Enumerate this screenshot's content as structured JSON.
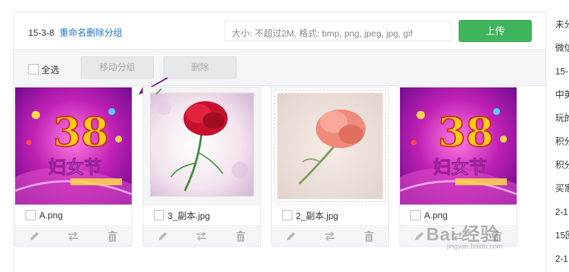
{
  "header": {
    "group_name": "15-3-8",
    "rename_link": "重命名",
    "delete_group_link": "删除分组",
    "upload_hint": "大小: 不超过2M,    格式: bmp, png, jpeg, jpg, gif",
    "upload_button": "上传"
  },
  "toolbar": {
    "select_all": "全选",
    "move_group": "移动分组",
    "delete": "删除"
  },
  "images": [
    {
      "filename": "A.png",
      "thumb": "womens-day-poster"
    },
    {
      "filename": "3_副本.jpg",
      "thumb": "red-carnation-photo"
    },
    {
      "filename": "2_副本.jpg",
      "thumb": "pink-carnation-photo"
    },
    {
      "filename": "A.png",
      "thumb": "womens-day-poster"
    }
  ],
  "sidebar": {
    "items": [
      "未分",
      "微信",
      "15-",
      "中英",
      "玩的",
      "积分",
      "积分",
      "买家",
      "2-1",
      "15回",
      "2-1"
    ]
  },
  "watermark": {
    "main": "Bai 经验",
    "sub": "jingyan.baidu.com"
  },
  "colors": {
    "accent_green": "#3eb55a",
    "link_blue": "#1a6fc9",
    "arrow_purple": "#7b1f8c"
  }
}
